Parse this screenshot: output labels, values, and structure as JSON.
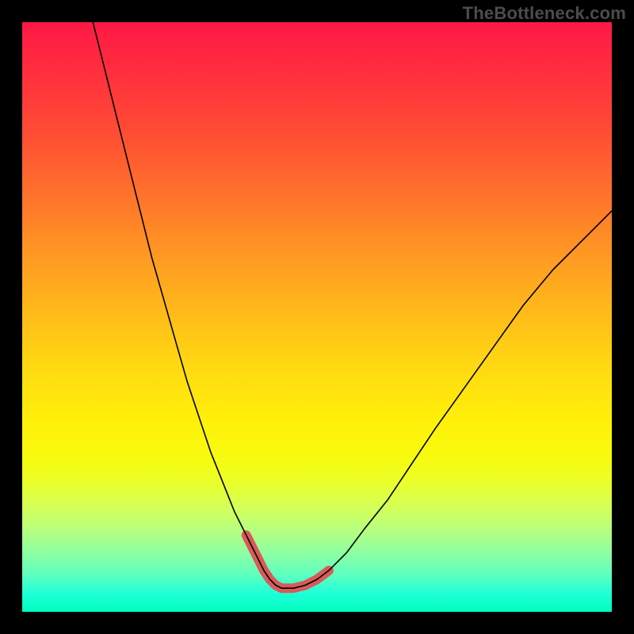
{
  "watermark": "TheBottleneck.com",
  "chart_data": {
    "type": "line",
    "title": "",
    "xlabel": "",
    "ylabel": "",
    "xlim": [
      0,
      100
    ],
    "ylim": [
      0,
      100
    ],
    "grid": false,
    "legend": false,
    "series": [
      {
        "name": "bottleneck-curve",
        "x": [
          12,
          14,
          16,
          18,
          20,
          22,
          24,
          26,
          28,
          30,
          32,
          34,
          36,
          38,
          40,
          41,
          42,
          43,
          44,
          46,
          48,
          50,
          52,
          55,
          58,
          62,
          66,
          70,
          75,
          80,
          85,
          90,
          95,
          100
        ],
        "y": [
          100,
          92,
          84,
          76,
          68,
          60,
          53,
          46,
          39,
          33,
          27,
          22,
          17,
          13,
          9,
          7,
          5.5,
          4.5,
          4,
          4,
          4.5,
          5.5,
          7,
          10,
          14,
          19,
          25,
          31,
          38,
          45,
          52,
          58,
          63,
          68
        ]
      },
      {
        "name": "optimal-zone-highlight",
        "x": [
          38,
          40,
          41,
          42,
          43,
          44,
          46,
          48,
          50,
          52
        ],
        "y": [
          13,
          9,
          7,
          5.5,
          4.5,
          4,
          4,
          4.5,
          5.5,
          7
        ]
      }
    ],
    "colors": {
      "curve": "#000000",
      "highlight": "#d95a5a",
      "gradient_top": "#ff1846",
      "gradient_bottom": "#00ffbf"
    }
  }
}
